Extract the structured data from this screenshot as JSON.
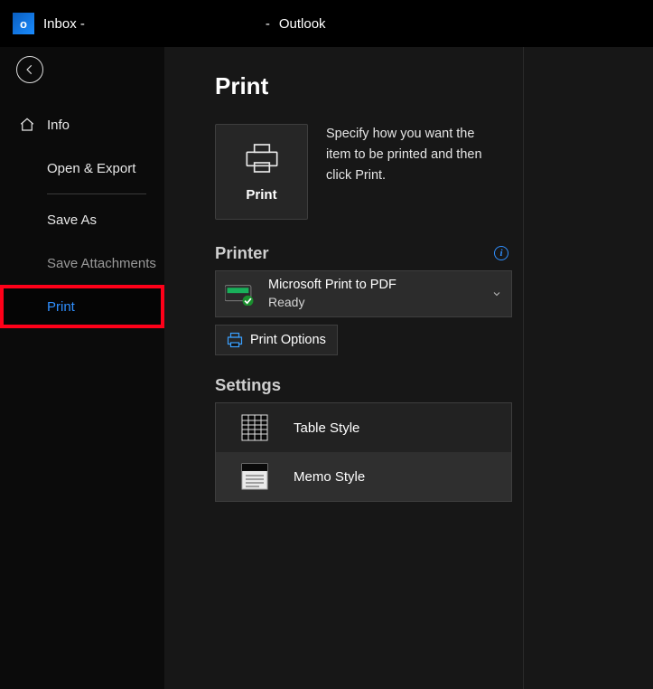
{
  "titlebar": {
    "prefix": "Inbox -",
    "dash": "-",
    "appname": "Outlook"
  },
  "sidebar": {
    "info": "Info",
    "open_export": "Open & Export",
    "save_as": "Save As",
    "save_attachments": "Save Attachments",
    "print": "Print"
  },
  "main": {
    "title": "Print",
    "print_button": "Print",
    "description": "Specify how you want the item to be printed and then click Print.",
    "printer_heading": "Printer",
    "printer_name": "Microsoft Print to PDF",
    "printer_status": "Ready",
    "print_options": "Print Options",
    "settings_heading": "Settings",
    "style_table": "Table Style",
    "style_memo": "Memo Style"
  }
}
